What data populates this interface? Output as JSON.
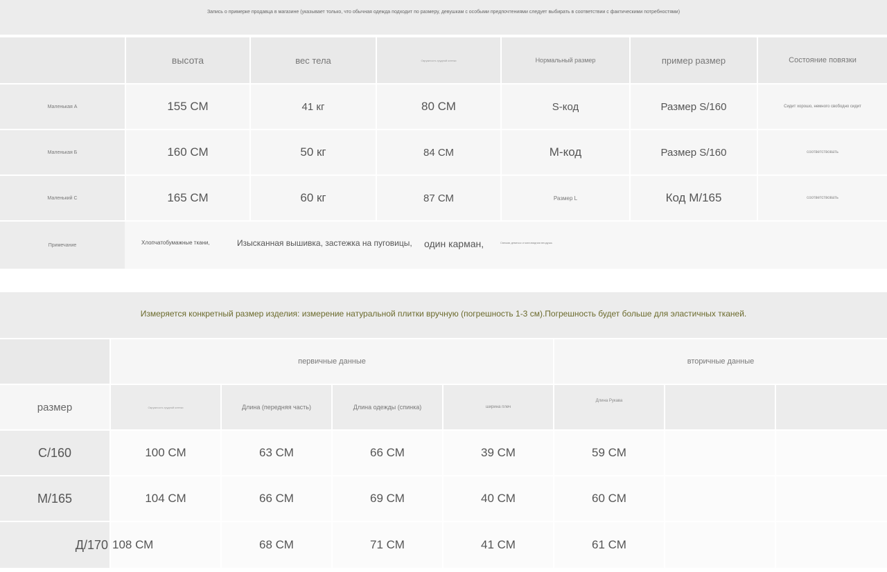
{
  "top_notice": "Запись о примерке продавца в магазине (указывает только, что обычная одежда подходит по размеру, девушкам с особыми предпочтениями следует выбирать в соответствии с фактическими потребностями)",
  "table1": {
    "headers": {
      "height": "высота",
      "weight": "вес тела",
      "bust": "Окружность грудной клетки",
      "normal_size": "Нормальный размер",
      "tryon_size": "пример размер",
      "bandage_state": "Состояние повязки"
    },
    "rows": [
      {
        "label": "Маленькая A",
        "height": "155 СМ",
        "weight": "41 кг",
        "bust": "80 СМ",
        "normal": "S-код",
        "tryon": "Размер S/160",
        "state": "Сидит хорошо, немного свободно сидит"
      },
      {
        "label": "Маленькая Б",
        "height": "160 СМ",
        "weight": "50 кг",
        "bust": "84 СМ",
        "normal": "М-код",
        "tryon": "Размер S/160",
        "state": "соответствовать"
      },
      {
        "label": "Маленький C",
        "height": "165 СМ",
        "weight": "60 кг",
        "bust": "87 СМ",
        "normal": "Размер L",
        "tryon": "Код M/165",
        "state": "соответствовать"
      }
    ],
    "note_label": "Примечание",
    "note_parts": [
      "Хлопчатобумажные ткани,",
      "Изысканная вышивка, застежка на пуговицы,",
      "один карман,",
      "Свежая девичья и миловидная вподушь"
    ]
  },
  "measure_notice": "Измеряется конкретный размер изделия: измерение натуральной плитки вручную (погрешность 1-3 см).Погрешность будет больше для эластичных тканей.",
  "table2": {
    "group_primary": "первичные данные",
    "group_secondary": "вторичные данные",
    "size_label": "размер",
    "col_headers": [
      "Окружность грудной клетки",
      "Длина (передняя часть)",
      "Длина одежды (спинка)",
      "ширина плеч",
      "Длина Рукава"
    ],
    "rows": [
      {
        "size": "С/160",
        "values": [
          "100 СМ",
          "63 СМ",
          "66 СМ",
          "39 СМ",
          "59 СМ"
        ]
      },
      {
        "size": "М/165",
        "values": [
          "104 СМ",
          "66 СМ",
          "69 СМ",
          "40 СМ",
          "60 СМ"
        ]
      },
      {
        "size": "Д/170",
        "values": [
          "108 СМ",
          "68 СМ",
          "71 СМ",
          "41 СМ",
          "61 СМ"
        ]
      }
    ]
  }
}
